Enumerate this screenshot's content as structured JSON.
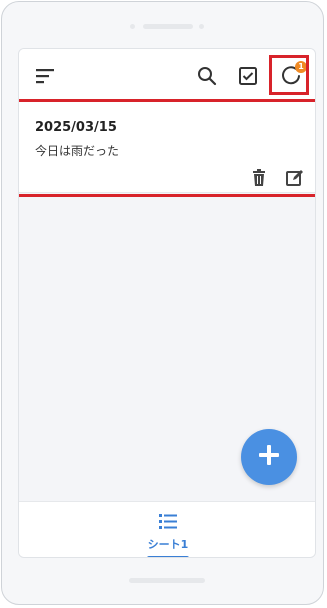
{
  "header": {
    "sync_badge_count": "1"
  },
  "note": {
    "date": "2025/03/15",
    "text": "今日は雨だった"
  },
  "tabs": [
    {
      "label": "シート1",
      "selected": true
    }
  ],
  "colors": {
    "primary": "#4a90e2",
    "badge": "#f08a24",
    "highlight": "#d8232a"
  }
}
